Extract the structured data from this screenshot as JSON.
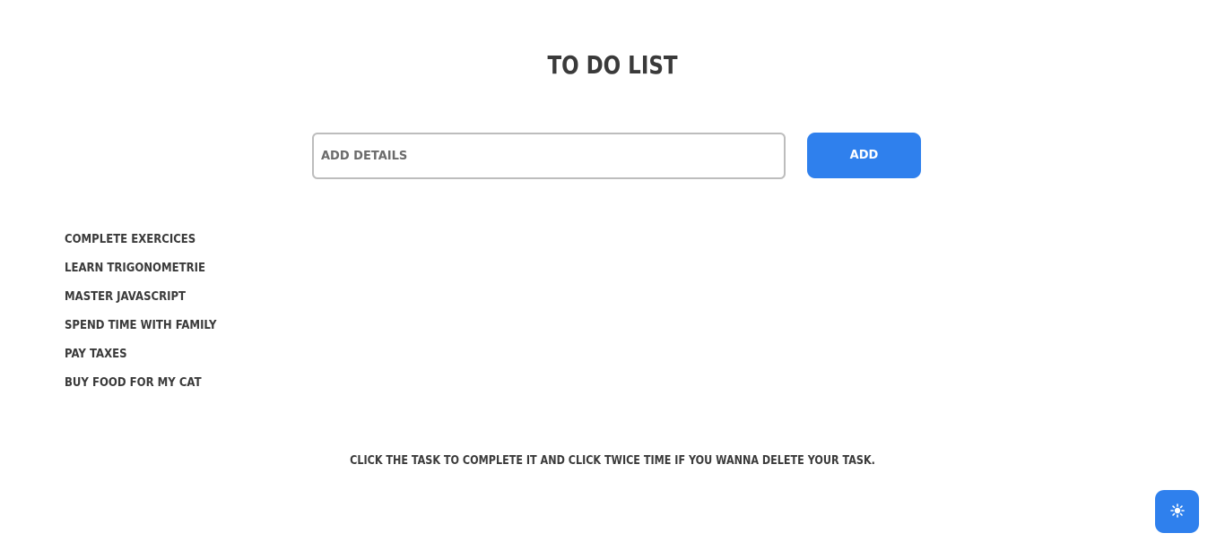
{
  "header": {
    "title": "TO DO LIST"
  },
  "form": {
    "placeholder": "ADD DETAILS",
    "add_label": "ADD"
  },
  "tasks": [
    {
      "label": "COMPLETE EXERCICES"
    },
    {
      "label": "LEARN TRIGONOMETRIE"
    },
    {
      "label": "MASTER JAVASCRIPT"
    },
    {
      "label": "SPEND TIME WITH FAMILY"
    },
    {
      "label": "PAY TAXES"
    },
    {
      "label": "BUY FOOD FOR MY CAT"
    }
  ],
  "footer": {
    "hint": "CLICK THE TASK TO COMPLETE IT AND CLICK TWICE TIME IF YOU WANNA DELETE YOUR TASK."
  },
  "theme_toggle": {
    "icon": "sun-icon"
  },
  "colors": {
    "accent": "#2f80ed",
    "text": "#3a3a3a",
    "input_border": "#bdbdbd"
  }
}
